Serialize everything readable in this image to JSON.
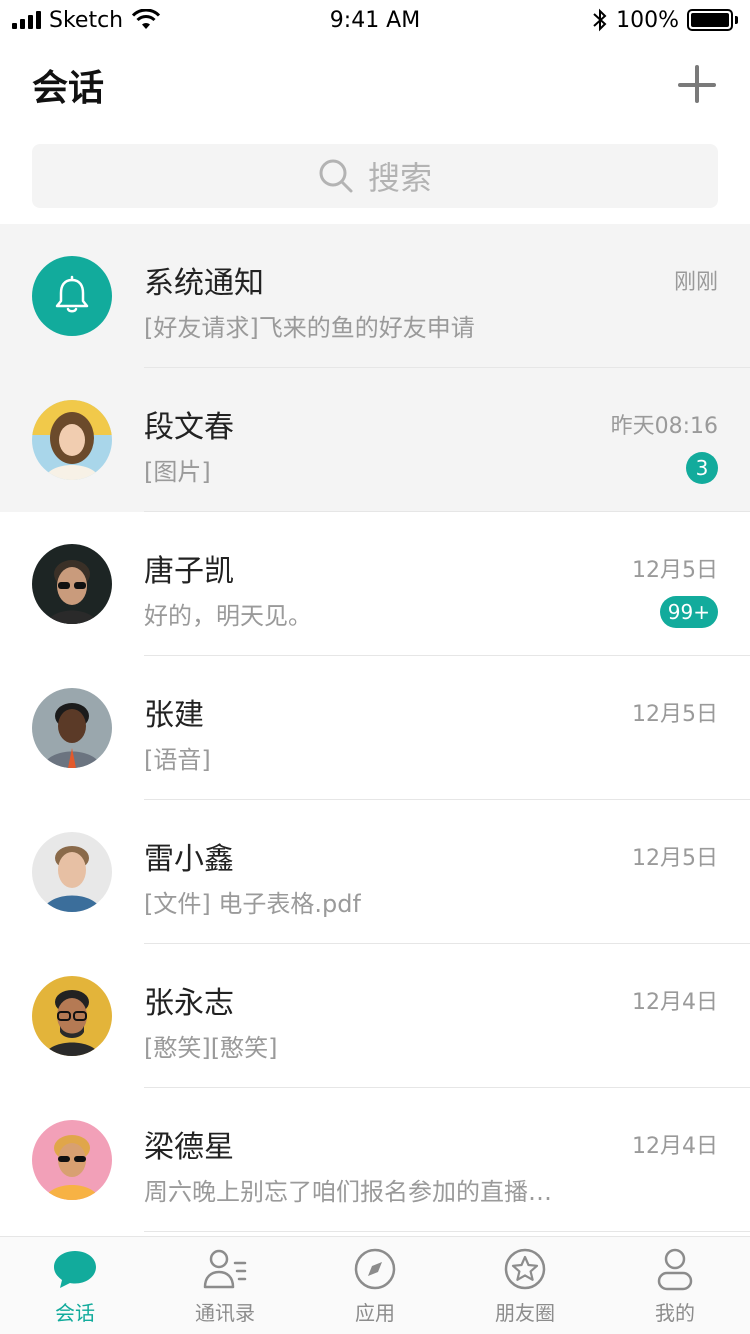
{
  "status_bar": {
    "carrier": "Sketch",
    "time": "9:41 AM",
    "battery": "100%"
  },
  "header": {
    "title": "会话",
    "add_icon": "plus-icon"
  },
  "search": {
    "placeholder": "搜索",
    "icon": "search-icon"
  },
  "conversations": [
    {
      "name": "系统通知",
      "preview": "[好友请求]飞来的鱼的好友申请",
      "time": "刚刚",
      "badge": "",
      "avatar": "bell-icon",
      "highlight": true
    },
    {
      "name": "段文春",
      "preview": "[图片]",
      "time": "昨天08:16",
      "badge": "3",
      "avatar": "photo",
      "highlight": true
    },
    {
      "name": "唐子凯",
      "preview": "好的，明天见。",
      "time": "12月5日",
      "badge": "99+",
      "avatar": "photo",
      "highlight": false
    },
    {
      "name": "张建",
      "preview": "[语音]",
      "time": "12月5日",
      "badge": "",
      "avatar": "photo",
      "highlight": false
    },
    {
      "name": "雷小鑫",
      "preview": "[文件] 电子表格.pdf",
      "time": "12月5日",
      "badge": "",
      "avatar": "photo",
      "highlight": false
    },
    {
      "name": "张永志",
      "preview": "[憨笑][憨笑]",
      "time": "12月4日",
      "badge": "",
      "avatar": "photo",
      "highlight": false
    },
    {
      "name": "梁德星",
      "preview": "周六晚上别忘了咱们报名参加的直播…",
      "time": "12月4日",
      "badge": "",
      "avatar": "photo",
      "highlight": false
    }
  ],
  "tabs": [
    {
      "label": "会话",
      "icon": "chat-bubble-icon",
      "active": true
    },
    {
      "label": "通讯录",
      "icon": "contacts-icon",
      "active": false
    },
    {
      "label": "应用",
      "icon": "compass-icon",
      "active": false
    },
    {
      "label": "朋友圈",
      "icon": "star-icon",
      "active": false
    },
    {
      "label": "我的",
      "icon": "person-icon",
      "active": false
    }
  ],
  "colors": {
    "accent": "#12ab9c",
    "highlight_row": "#f4f4f4",
    "secondary_text": "#9a9a9a"
  }
}
